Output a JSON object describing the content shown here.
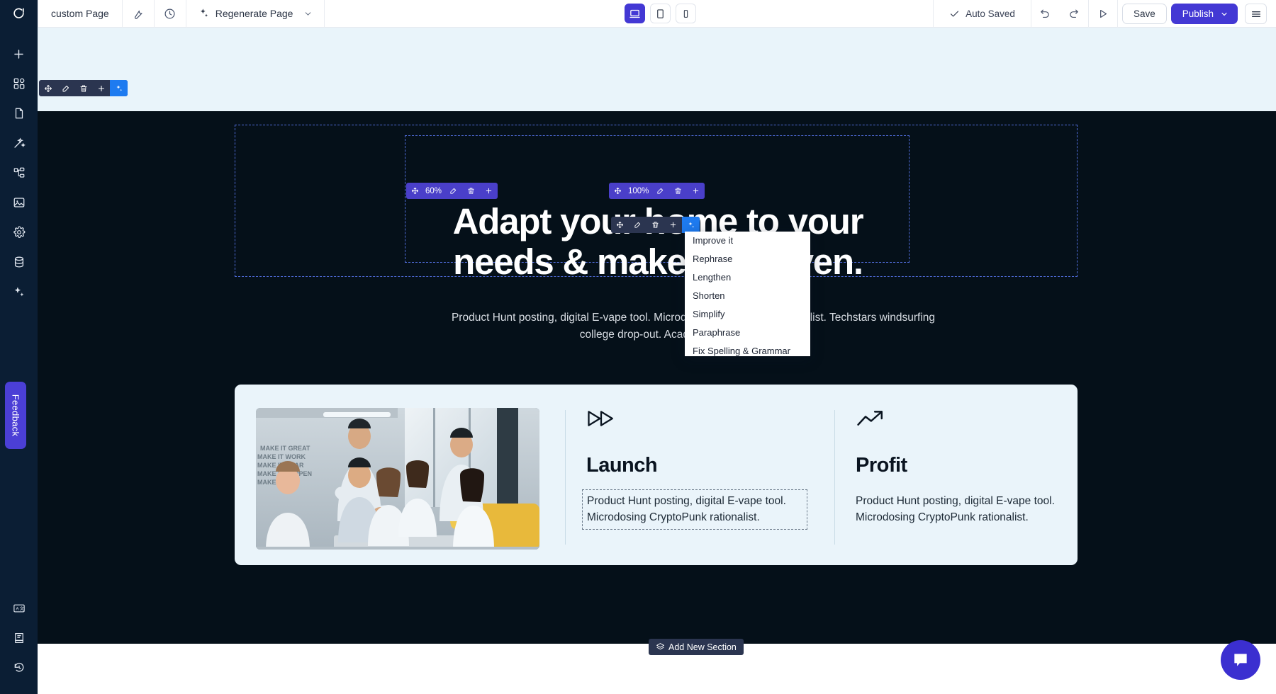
{
  "topbar": {
    "logo": "logo-glyph",
    "page_title": "custom Page",
    "wrench_icon": "wrench-icon",
    "history_icon": "clock-icon",
    "regenerate_label": "Regenerate Page",
    "regenerate_sparkle_icon": "sparkles-icon",
    "regenerate_chevron": "chevron-down-icon",
    "viewports": [
      {
        "name": "desktop",
        "icon": "laptop-icon",
        "active": true
      },
      {
        "name": "tablet",
        "icon": "tablet-icon",
        "active": false
      },
      {
        "name": "mobile",
        "icon": "phone-icon",
        "active": false
      }
    ],
    "autosaved_label": "Auto Saved",
    "autosaved_check_icon": "check-icon",
    "undo_icon": "undo-icon",
    "redo_icon": "redo-icon",
    "preview_icon": "play-icon",
    "save_label": "Save",
    "publish_label": "Publish",
    "publish_chevron": "chevron-down-icon",
    "menu_icon": "hamburger-icon"
  },
  "rail": {
    "items": [
      {
        "name": "add",
        "icon": "plus-icon"
      },
      {
        "name": "blocks",
        "icon": "grid-blocks-icon"
      },
      {
        "name": "pages",
        "icon": "page-icon"
      },
      {
        "name": "design",
        "icon": "magic-wand-icon"
      },
      {
        "name": "layers",
        "icon": "sitemap-icon"
      },
      {
        "name": "media",
        "icon": "image-icon"
      },
      {
        "name": "settings",
        "icon": "gear-icon"
      },
      {
        "name": "database",
        "icon": "database-icon"
      },
      {
        "name": "ai",
        "icon": "sparkles-icon"
      }
    ],
    "feedback_label": "Feedback",
    "bottom_items": [
      {
        "name": "translate",
        "icon": "translate-icon"
      },
      {
        "name": "docs",
        "icon": "book-icon"
      },
      {
        "name": "history",
        "icon": "restore-icon"
      }
    ]
  },
  "toolbars": {
    "icons": {
      "move": "move-icon",
      "edit": "pencil-square-icon",
      "delete": "trash-icon",
      "add": "plus-icon",
      "ai": "sparkles-icon"
    },
    "section_toolbar": {
      "zoom": ""
    },
    "heading_toolbar": {
      "zoom": "60%"
    },
    "container_toolbar": {
      "zoom": "100%"
    },
    "text_toolbar": {
      "zoom": ""
    }
  },
  "ai_menu": {
    "items": [
      "Improve it",
      "Rephrase",
      "Lengthen",
      "Shorten",
      "Simplify",
      "Paraphrase",
      "Fix Spelling & Grammar"
    ]
  },
  "hero": {
    "heading": "Adapt your home to your needs & make it a haven.",
    "paragraph": "Product Hunt posting, digital E-vape tool. Microdosing CryptoPunk rationalist. Techstars windsurfing college drop-out. Academia Cypherpunk uphill."
  },
  "features": {
    "photo_alt": "team-meeting-photo",
    "columns": [
      {
        "icon": "fast-forward-icon",
        "title": "Launch",
        "body": "Product Hunt posting, digital E-vape tool. Microdosing CryptoPunk rationalist."
      },
      {
        "icon": "trending-up-icon",
        "title": "Profit",
        "body": "Product Hunt posting, digital E-vape tool. Microdosing CryptoPunk rationalist."
      }
    ]
  },
  "canvas": {
    "add_section_label": "Add New Section",
    "add_section_icon": "layers-icon",
    "chat_icon": "chat-bubble-icon"
  },
  "colors": {
    "accent": "#4338d4",
    "ai_blue": "#1e7bf0",
    "dark_section": "#051019",
    "light_band": "#e9f4fa",
    "rail": "#0b1e34"
  }
}
